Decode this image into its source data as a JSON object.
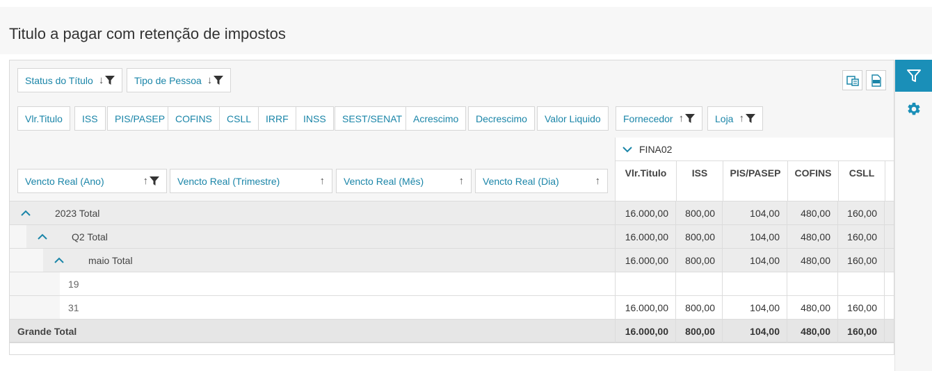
{
  "page": {
    "title": "Titulo a pagar com retenção de impostos"
  },
  "filters": {
    "status_titulo": "Status do Título",
    "tipo_pessoa": "Tipo de Pessoa"
  },
  "measures": [
    "Vlr.Titulo",
    "ISS",
    "PIS/PASEP",
    "COFINS",
    "CSLL",
    "IRRF",
    "INSS",
    "SEST/SENAT",
    "Acrescimo",
    "Decrescimo",
    "Valor Liquido"
  ],
  "column_fields": {
    "fornecedor": "Fornecedor",
    "loja": "Loja"
  },
  "row_fields": {
    "ano": "Vencto Real (Ano)",
    "trimestre": "Vencto Real (Trimestre)",
    "mes": "Vencto Real (Mês)",
    "dia": "Vencto Real (Dia)"
  },
  "column_group": "FINA02",
  "columns": [
    "Vlr.Titulo",
    "ISS",
    "PIS/PASEP",
    "COFINS",
    "CSLL"
  ],
  "rows": [
    {
      "label": "2023 Total",
      "values": [
        "16.000,00",
        "800,00",
        "104,00",
        "480,00",
        "160,00"
      ]
    },
    {
      "label": "Q2 Total",
      "values": [
        "16.000,00",
        "800,00",
        "104,00",
        "480,00",
        "160,00"
      ]
    },
    {
      "label": "maio Total",
      "values": [
        "16.000,00",
        "800,00",
        "104,00",
        "480,00",
        "160,00"
      ]
    },
    {
      "label": "19",
      "values": [
        "",
        "",
        "",
        "",
        ""
      ]
    },
    {
      "label": "31",
      "values": [
        "16.000,00",
        "800,00",
        "104,00",
        "480,00",
        "160,00"
      ]
    }
  ],
  "grand_total": {
    "label": "Grande Total",
    "values": [
      "16.000,00",
      "800,00",
      "104,00",
      "480,00",
      "160,00"
    ]
  },
  "icons": {
    "sort_desc": "arrow-down-icon",
    "sort_asc": "arrow-up-icon",
    "filter": "filter-icon",
    "gear": "gear-icon",
    "collapse": "chevron-up-icon",
    "expand": "chevron-down-icon",
    "export_excel": "excel-export-icon",
    "export_xlsx": "xlsx-export-icon"
  },
  "colors": {
    "accent": "#1a8fb8",
    "link": "#1a85a8",
    "band": "#ececec",
    "grand_total_bg": "#e6e6e6"
  }
}
